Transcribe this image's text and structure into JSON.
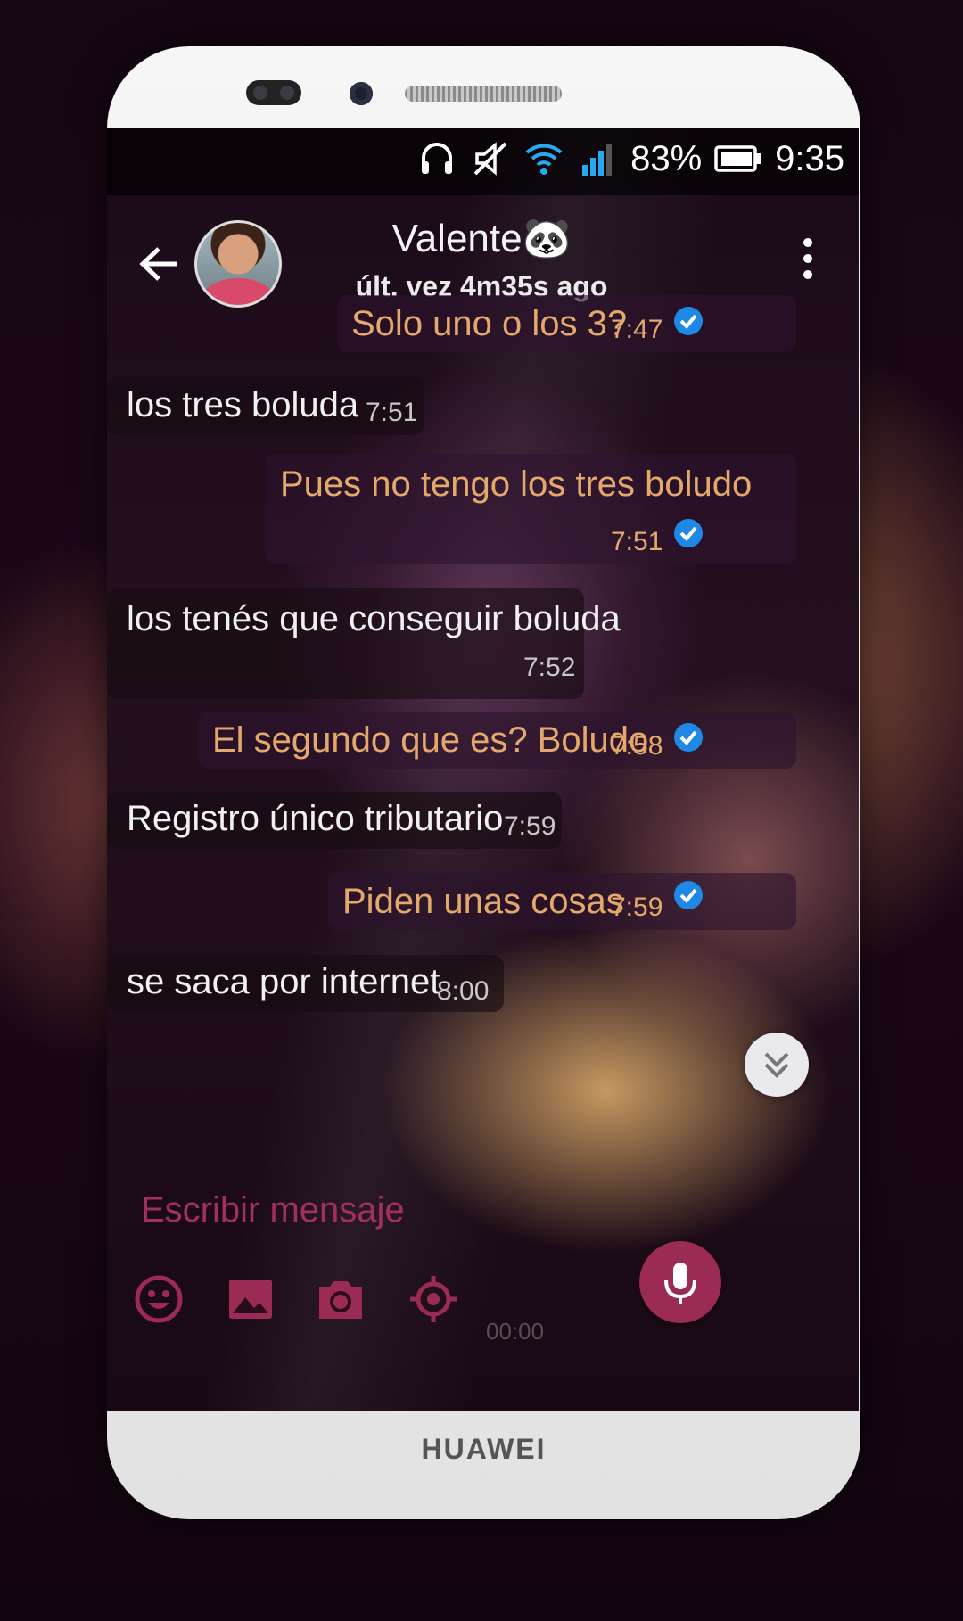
{
  "status_bar": {
    "battery": "83%",
    "time": "9:35"
  },
  "header": {
    "contact_name": "Valente🐼",
    "last_seen": "últ. vez 4m35s ago"
  },
  "messages": [
    {
      "direction": "out",
      "text": "Solo uno o los 3?",
      "time": "7:47",
      "read": true
    },
    {
      "direction": "in",
      "text": "los tres boluda",
      "time": "7:51"
    },
    {
      "direction": "out",
      "text": "Pues no tengo los tres boludo",
      "time": "7:51",
      "read": true
    },
    {
      "direction": "in",
      "text": "los tenés que conseguir boluda",
      "time": "7:52"
    },
    {
      "direction": "out",
      "text": "El segundo que es? Boludo",
      "time": "7:58",
      "read": true
    },
    {
      "direction": "in",
      "text": "Registro único tributario",
      "time": "7:59"
    },
    {
      "direction": "out",
      "text": "Piden unas cosas",
      "time": "7:59",
      "read": true
    },
    {
      "direction": "in",
      "text": "se saca por internet",
      "time": "8:00"
    }
  ],
  "composer": {
    "placeholder": "Escribir mensaje",
    "timer": "00:00",
    "icons": [
      "emoji-icon",
      "gallery-icon",
      "camera-icon",
      "location-icon",
      "microphone-icon"
    ]
  },
  "device": {
    "brand": "HUAWEI"
  },
  "colors": {
    "accent": "#9b2b54",
    "outgoing_text": "#e3a86b",
    "incoming_text": "#f1f1f1",
    "read_check": "#1e88e5"
  }
}
